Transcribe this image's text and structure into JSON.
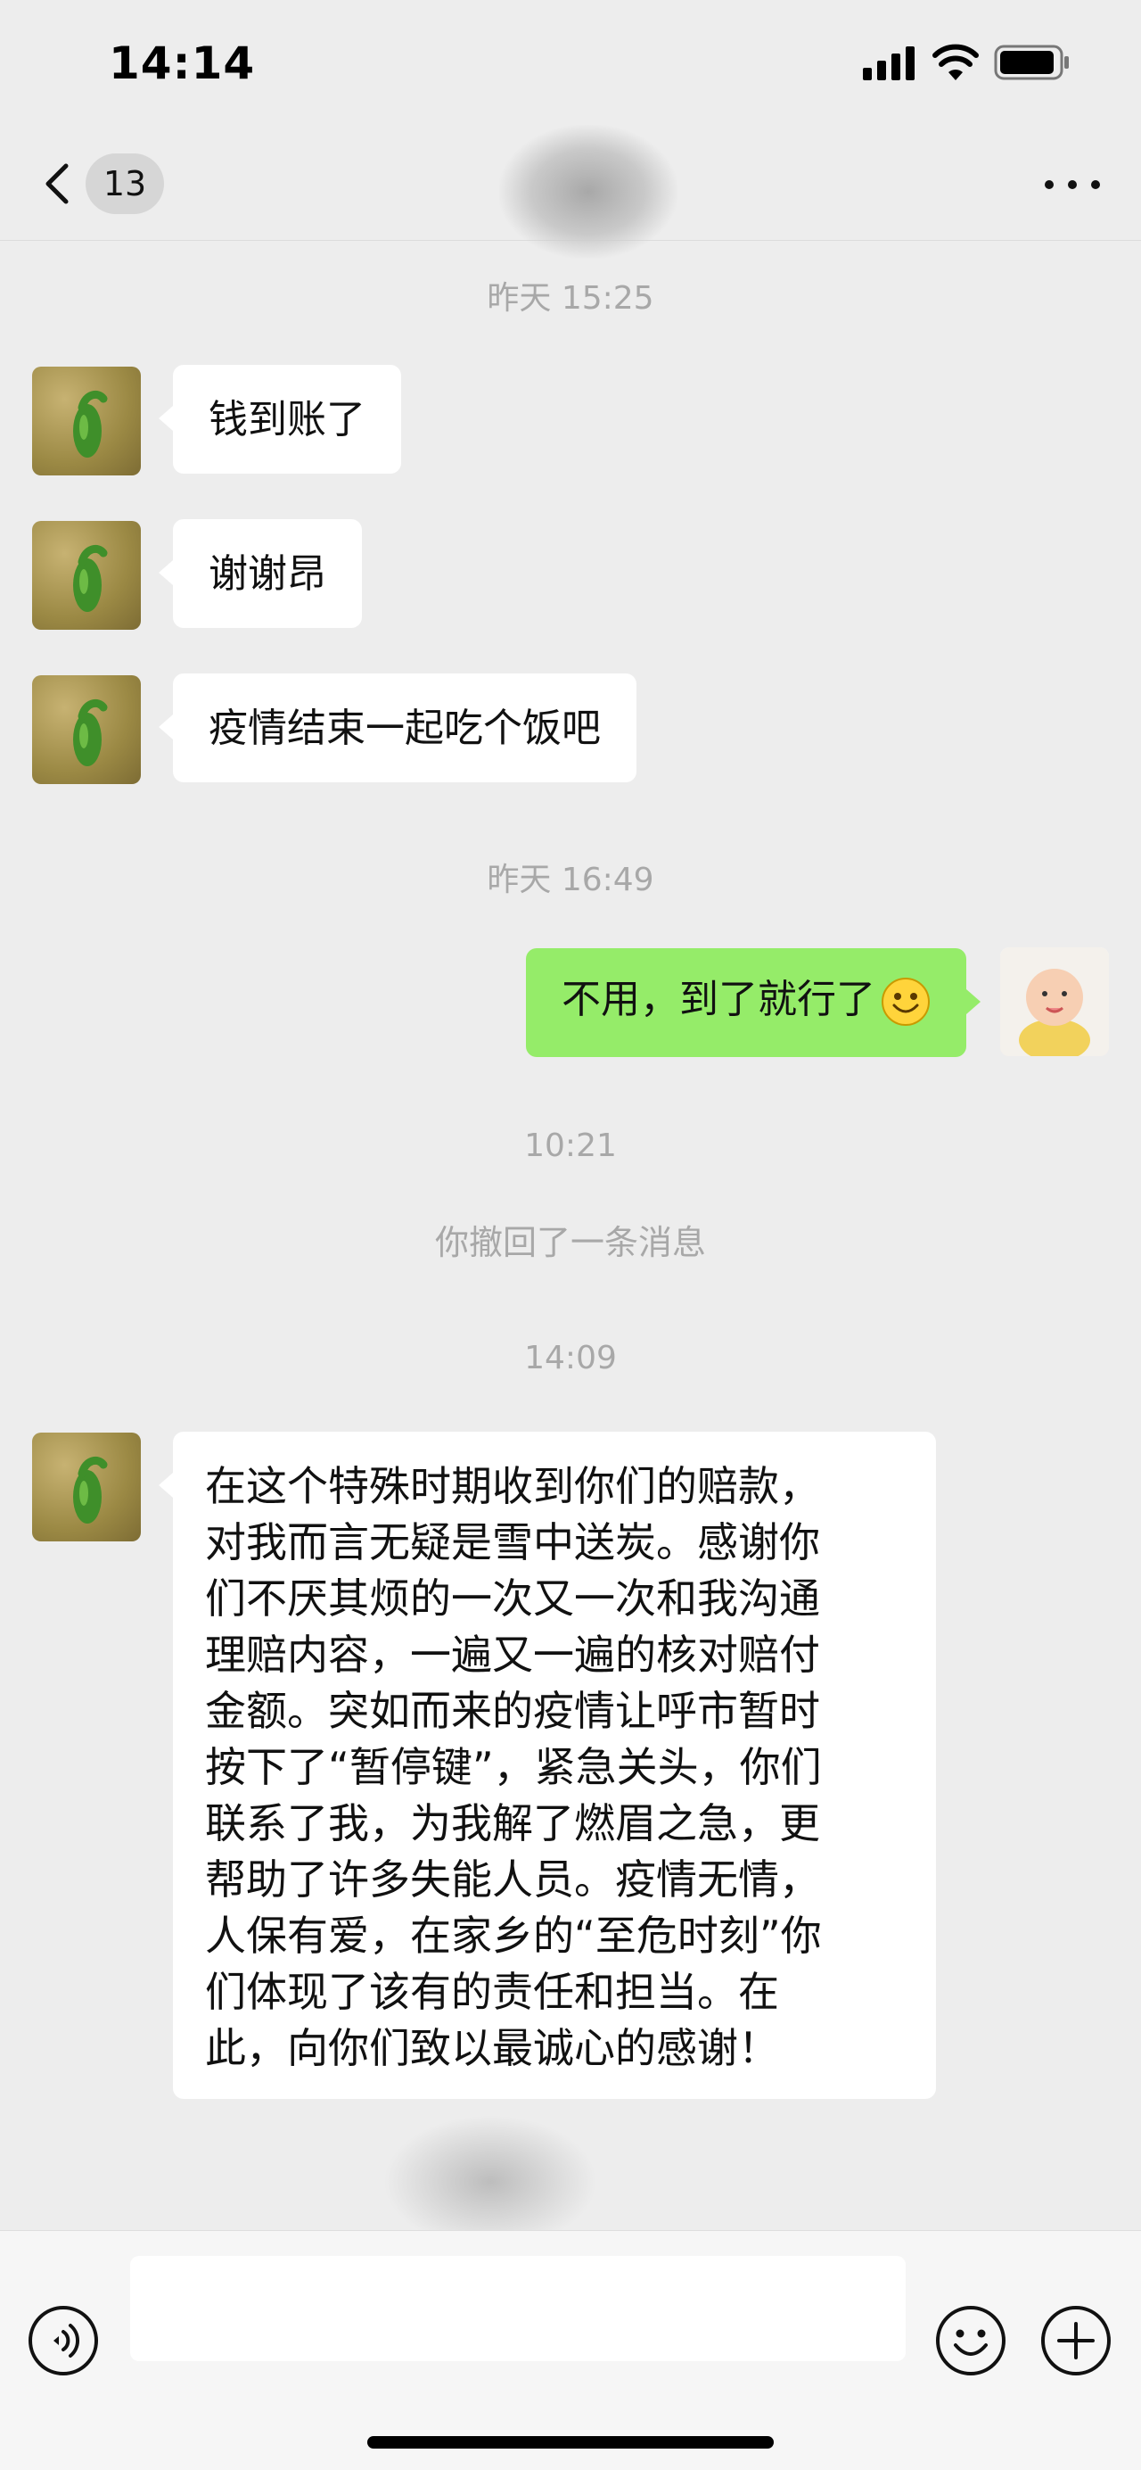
{
  "status_bar": {
    "time": "14:14",
    "icons": [
      "signal-icon",
      "wifi-icon",
      "battery-icon"
    ]
  },
  "nav": {
    "unread_count": "13",
    "icons": [
      "back-chevron-icon",
      "more-icon"
    ]
  },
  "messages": [
    {
      "type": "timestamp",
      "text": "昨天 15:25"
    },
    {
      "type": "incoming",
      "text": "钱到账了"
    },
    {
      "type": "incoming",
      "text": "谢谢昂"
    },
    {
      "type": "incoming",
      "text": "疫情结束一起吃个饭吧"
    },
    {
      "type": "timestamp",
      "text": "昨天 16:49"
    },
    {
      "type": "outgoing",
      "text": "不用，到了就行了",
      "emoji": "smile-emoji-icon"
    },
    {
      "type": "timestamp",
      "text": "10:21"
    },
    {
      "type": "system",
      "text": "你撤回了一条消息"
    },
    {
      "type": "timestamp",
      "text": "14:09"
    },
    {
      "type": "incoming",
      "lines": [
        "在这个特殊时期收到你们的赔款，",
        "对我而言无疑是雪中送炭。感谢你",
        "们不厌其烦的一次又一次和我沟通",
        "理赔内容，一遍又一遍的核对赔付",
        "金额。突如而来的疫情让呼市暂时",
        "按下了“暂停键”，紧急关头，你们",
        "联系了我，为我解了燃眉之急，更",
        "帮助了许多失能人员。疫情无情，",
        "人保有爱，在家乡的“至危时刻”你",
        "们体现了该有的责任和担当。在",
        "此，向你们致以最诚心的感谢！"
      ]
    }
  ],
  "input_bar": {
    "placeholder": "",
    "icons": [
      "voice-icon",
      "emoji-icon",
      "plus-icon"
    ]
  },
  "colors": {
    "background": "#ededed",
    "outgoing_bubble": "#95ec69",
    "incoming_bubble": "#ffffff",
    "timestamp_text": "#a8a8a8"
  }
}
